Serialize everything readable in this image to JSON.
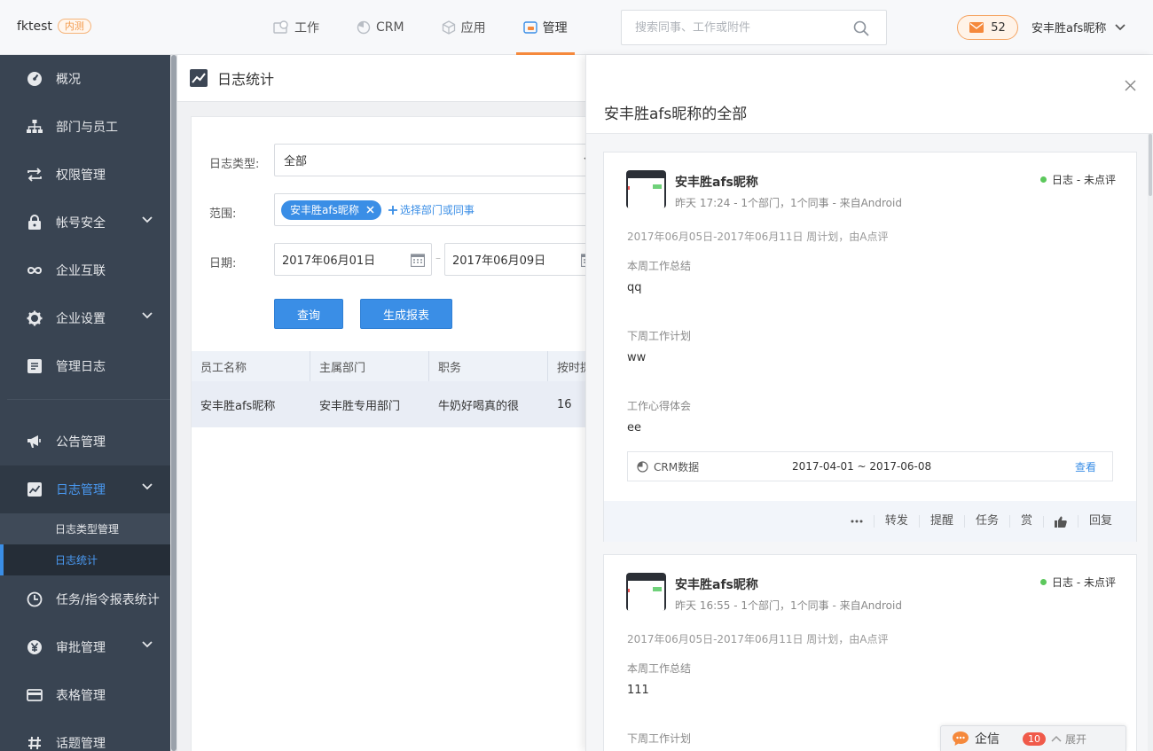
{
  "app": {
    "brand": "fktest",
    "beta_badge": "内测"
  },
  "nav": {
    "items": [
      {
        "label": "工作"
      },
      {
        "label": "CRM"
      },
      {
        "label": "应用"
      },
      {
        "label": "管理",
        "active": true
      }
    ]
  },
  "search": {
    "placeholder": "搜索同事、工作或附件"
  },
  "messages": {
    "count": "52"
  },
  "user": {
    "name": "安丰胜afs昵称"
  },
  "sidebar": {
    "items": [
      {
        "label": "概况",
        "icon": "dashboard-icon"
      },
      {
        "label": "部门与员工",
        "icon": "org-chart-icon"
      },
      {
        "label": "权限管理",
        "icon": "swap-icon"
      },
      {
        "label": "帐号安全",
        "icon": "lock-icon"
      },
      {
        "label": "企业互联",
        "icon": "infinity-icon"
      },
      {
        "label": "企业设置",
        "icon": "gear-icon"
      },
      {
        "label": "管理日志",
        "icon": "document-icon"
      },
      {
        "label": "公告管理",
        "icon": "megaphone-icon"
      },
      {
        "label": "日志管理",
        "icon": "chart-line-icon"
      },
      {
        "label": "任务/指令报表统计",
        "icon": "clock-icon"
      },
      {
        "label": "审批管理",
        "icon": "yen-icon"
      },
      {
        "label": "表格管理",
        "icon": "card-icon"
      },
      {
        "label": "话题管理",
        "icon": "hash-icon"
      }
    ],
    "sub_items": [
      {
        "label": "日志类型管理"
      },
      {
        "label": "日志统计",
        "active": true
      }
    ]
  },
  "main": {
    "title": "日志统计",
    "form": {
      "type_label": "日志类型:",
      "type_value": "全部",
      "scope_label": "范围:",
      "scope_tag": "安丰胜afs昵称",
      "scope_add": "选择部门或同事",
      "date_label": "日期:",
      "date_start": "2017年06月01日",
      "date_sep": "–",
      "date_end": "2017年06月09日"
    },
    "buttons": {
      "query": "查询",
      "report": "生成报表"
    },
    "table": {
      "headers": [
        "员工名称",
        "主属部门",
        "职务",
        "按时提"
      ],
      "rows": [
        [
          "安丰胜afs昵称",
          "安丰胜专用部门",
          "牛奶好喝真的很",
          "16"
        ]
      ]
    }
  },
  "drawer": {
    "title": "安丰胜afs昵称的全部",
    "posts": [
      {
        "author": "安丰胜afs昵称",
        "meta": "昨天 17:24 - 1个部门，1个同事 - 来自Android",
        "status": "日志 - 未点评",
        "period": "2017年06月05日-2017年06月11日 周计划，由A点评",
        "sections": [
          {
            "label": "本周工作总结",
            "value": "qq"
          },
          {
            "label": "下周工作计划",
            "value": "ww"
          },
          {
            "label": "工作心得体会",
            "value": "ee"
          }
        ],
        "crm_label": "CRM数据",
        "crm_range": "2017-04-01 ~ 2017-06-08",
        "crm_view": "查看",
        "actions": [
          "转发",
          "提醒",
          "任务",
          "赏",
          "回复"
        ]
      },
      {
        "author": "安丰胜afs昵称",
        "meta": "昨天 16:55 - 1个部门，1个同事 - 来自Android",
        "status": "日志 - 未点评",
        "period": "2017年06月05日-2017年06月11日 周计划，由A点评",
        "sections": [
          {
            "label": "本周工作总结",
            "value": "111"
          },
          {
            "label": "下周工作计划",
            "value": ""
          }
        ]
      }
    ]
  },
  "chat": {
    "label": "企信",
    "count": "10",
    "expand": "展开"
  },
  "colors": {
    "accent": "#3a8ee6",
    "orange": "#f5893c",
    "sidebar_bg": "#394452",
    "status_green": "#5cc85c",
    "badge_red": "#f05a4a"
  }
}
